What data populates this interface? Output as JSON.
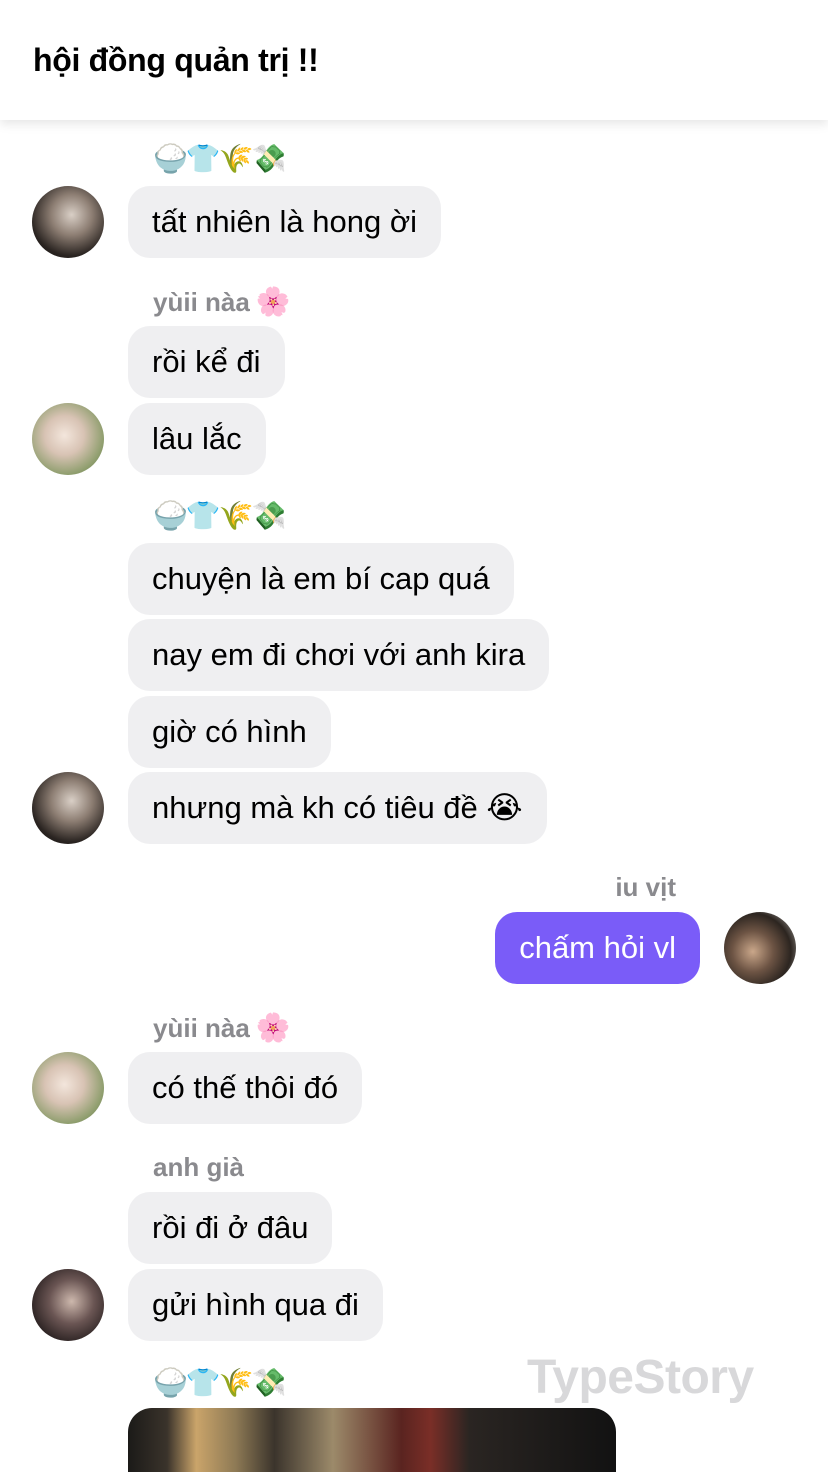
{
  "header": {
    "title": "hội đồng quản trị !!"
  },
  "messages": [
    {
      "sender": "🍚👕🌾💸",
      "text": "tất nhiên là hong ời"
    },
    {
      "sender": "yùii nàa",
      "sender_emoji": "🌸",
      "text": "rồi kể đi"
    },
    {
      "text": "lâu lắc"
    },
    {
      "sender": "🍚👕🌾💸",
      "text": "chuyện là em bí cap quá"
    },
    {
      "text": "nay em đi chơi với anh kira"
    },
    {
      "text": "giờ có hình"
    },
    {
      "text": "nhưng mà kh có tiêu đề 😭"
    },
    {
      "sender": "iu vịt",
      "text": "chấm hỏi vl"
    },
    {
      "sender": "yùii nàa",
      "sender_emoji": "🌸",
      "text": "có thế thôi đó"
    },
    {
      "sender": "anh già",
      "text": "rồi đi ở đâu"
    },
    {
      "text": "gửi hình qua đi"
    },
    {
      "sender": "🍚👕🌾💸"
    }
  ],
  "watermark": "TypeStory",
  "colors": {
    "my_bubble": "#7a5cf8",
    "other_bubble": "#efeff1",
    "sender_name": "#8a8a8e"
  }
}
